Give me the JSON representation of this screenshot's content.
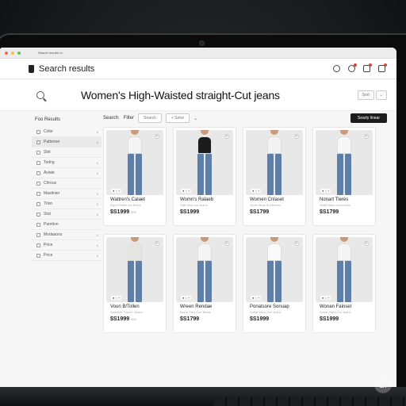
{
  "browser": {
    "tab_title": "Search results •••"
  },
  "header": {
    "title": "Search results"
  },
  "search": {
    "headline": "Women's High-Waisted straight-Cut jeans",
    "sort_label": "Sort",
    "sort_chevron": "⌄"
  },
  "sidebar": {
    "heading": "Foo Results",
    "items": [
      {
        "label": "Color",
        "count": "1"
      },
      {
        "label": "Patterner",
        "count": "1"
      },
      {
        "label": "Shit",
        "count": ""
      },
      {
        "label": "Todng",
        "count": "1"
      },
      {
        "label": "Aviate",
        "count": "1"
      },
      {
        "label": "Chrous",
        "count": ""
      },
      {
        "label": "Mastinier",
        "count": "1"
      },
      {
        "label": "Trion",
        "count": "1"
      },
      {
        "label": "Stut",
        "count": "1"
      },
      {
        "label": "Paortion",
        "count": ""
      },
      {
        "label": "Modaaons",
        "count": "1"
      },
      {
        "label": "Price",
        "count": "1"
      },
      {
        "label": "Price",
        "count": "1"
      }
    ]
  },
  "filterbar": {
    "search_label": "Search:",
    "filter_label": "Filter",
    "search_placeholder": "Search",
    "add_filter": "+ Setor",
    "chevron": "⌄",
    "button_label": "Searty linear"
  },
  "products": [
    {
      "name": "Wattren's Calaet",
      "sub": "Biyolf Pabel cut Bhinn",
      "price": "$S1999",
      "old": "$90",
      "shirt": "#f4f4f4"
    },
    {
      "name": "Womn's Ralaeb",
      "sub": "Stat Wrsf cut Jeans",
      "price": "$S1999",
      "old": "",
      "shirt": "#1b1b1b"
    },
    {
      "name": "Wornen Cnlaset",
      "sub": "Sorai Whal Sut Berms",
      "price": "$S1799",
      "old": "",
      "shirt": "#f2f2f2"
    },
    {
      "name": "Nonart Tleres",
      "sub": "Sealt Whul ont brands",
      "price": "$S1799",
      "old": "",
      "shirt": "#f7f7f7"
    },
    {
      "name": "Voun B/Tollen",
      "sub": "Sporfont Thurch Jeans",
      "price": "$S1999",
      "old": "$90",
      "shirt": "#e7e5e1"
    },
    {
      "name": "Wreen Rendae",
      "sub": "Brook Tilor Cut/ Bams",
      "price": "$S1799",
      "old": "",
      "shirt": "#f4f4f4"
    },
    {
      "name": "Ponatsore Sonuap",
      "sub": "Sorial Wha' Gut Jeans",
      "price": "$S1999",
      "old": "",
      "shirt": "#fafafa"
    },
    {
      "name": "Wonan Fainset",
      "sub": "Sonai Pafel Cut Jeans",
      "price": "$S1999",
      "old": "",
      "shirt": "#f5f5f5"
    }
  ],
  "colors": {
    "button_dark": "#1c1c1c",
    "denim": "#5d7fa8",
    "badge_red": "#d9413a"
  },
  "watermark": "ai"
}
